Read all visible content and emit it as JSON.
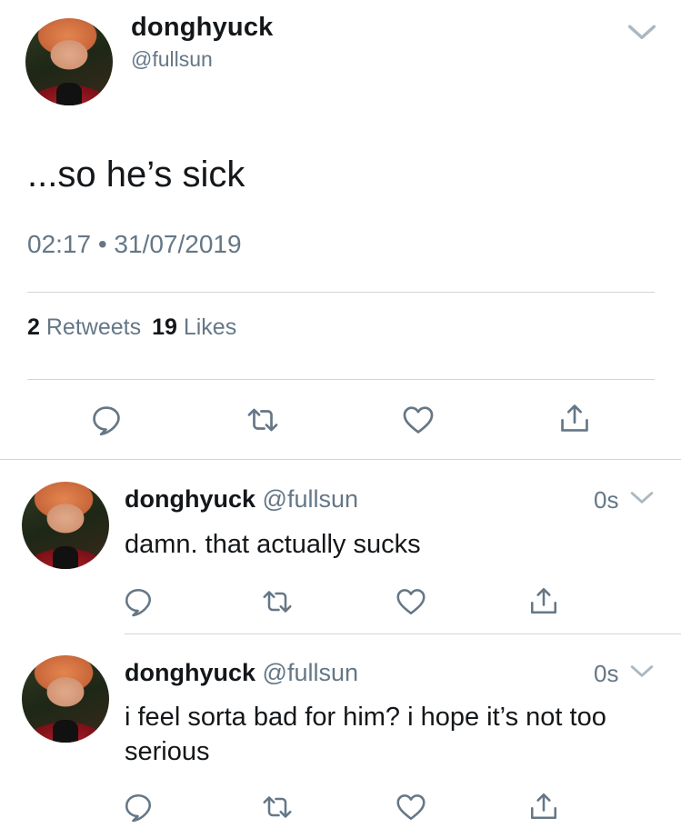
{
  "main_tweet": {
    "name": "donghyuck",
    "handle": "@fullsun",
    "text": "...so he’s sick",
    "timestamp": "02:17 • 31/07/2019",
    "retweets_count": "2",
    "retweets_label": "Retweets",
    "likes_count": "19",
    "likes_label": "Likes"
  },
  "replies": [
    {
      "name": "donghyuck",
      "handle": "@fullsun",
      "time": "0s",
      "text": "damn. that actually sucks"
    },
    {
      "name": "donghyuck",
      "handle": "@fullsun",
      "time": "0s",
      "text": "i feel sorta bad for him? i hope it’s not too serious"
    }
  ],
  "icons": {
    "reply": "reply-icon",
    "retweet": "retweet-icon",
    "like": "heart-icon",
    "share": "share-icon",
    "menu": "chevron-down-icon"
  },
  "colors": {
    "text": "#14171a",
    "secondary": "#657786",
    "divider": "#cfd6dc"
  }
}
